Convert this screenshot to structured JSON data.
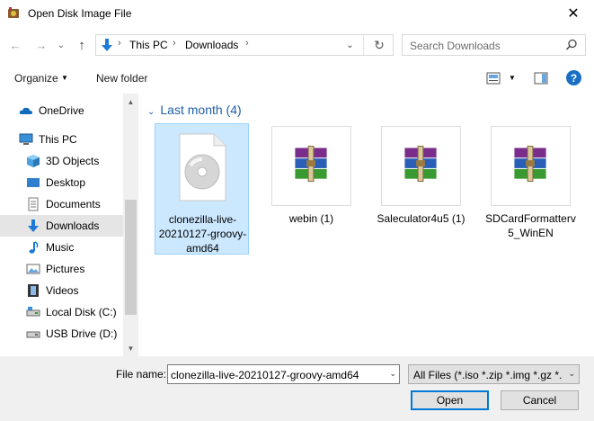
{
  "window": {
    "title": "Open Disk Image File",
    "close_glyph": "✕"
  },
  "nav": {
    "back_glyph": "←",
    "forward_glyph": "→",
    "recent_glyph": "⌄",
    "up_glyph": "↑",
    "breadcrumbs": [
      "This PC",
      "Downloads"
    ],
    "crumb_sep": "›",
    "dropdown_glyph": "⌄",
    "refresh_glyph": "↻"
  },
  "search": {
    "placeholder": "Search Downloads"
  },
  "toolbar": {
    "organize": "Organize",
    "new_folder": "New folder",
    "help": "?",
    "dropdown_glyph": "▼"
  },
  "sidebar": {
    "items": [
      {
        "label": "OneDrive",
        "icon": "cloud-icon"
      },
      {
        "label": "This PC",
        "icon": "computer-icon"
      },
      {
        "label": "3D Objects",
        "icon": "cube-icon"
      },
      {
        "label": "Desktop",
        "icon": "desktop-icon"
      },
      {
        "label": "Documents",
        "icon": "document-icon"
      },
      {
        "label": "Downloads",
        "icon": "download-arrow-icon",
        "selected": true
      },
      {
        "label": "Music",
        "icon": "music-note-icon"
      },
      {
        "label": "Pictures",
        "icon": "picture-icon"
      },
      {
        "label": "Videos",
        "icon": "film-icon"
      },
      {
        "label": "Local Disk (C:)",
        "icon": "drive-icon"
      },
      {
        "label": "USB Drive (D:)",
        "icon": "usb-drive-icon"
      }
    ],
    "scroll_up": "▲",
    "scroll_down": "▼"
  },
  "content": {
    "group": {
      "label": "Last month (4)",
      "chevron": "⌄"
    },
    "files": [
      {
        "name": "clonezilla-live-20210127-groovy-amd64",
        "icon": "disc-image-icon",
        "selected": true
      },
      {
        "name": "webin (1)",
        "icon": "winrar-archive-icon"
      },
      {
        "name": "Saleculator4u5 (1)",
        "icon": "winrar-archive-icon"
      },
      {
        "name": "SDCardFormatterv5_WinEN",
        "icon": "winrar-archive-icon"
      }
    ]
  },
  "footer": {
    "file_name_label": "File name:",
    "file_name_value": "clonezilla-live-20210127-groovy-amd64",
    "file_type_value": "All Files (*.iso *.zip *.img *.gz *.l",
    "dropdown_glyph": "⌄",
    "open_label": "Open",
    "cancel_label": "Cancel"
  },
  "colors": {
    "accent": "#0078d7",
    "selection": "#cce8ff",
    "header_blue": "#1f5fa8"
  }
}
